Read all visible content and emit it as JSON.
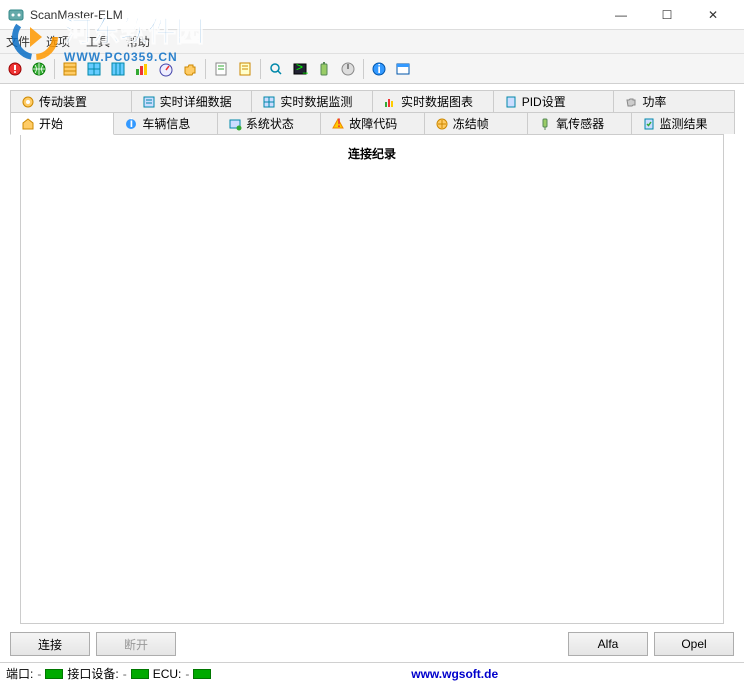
{
  "title": "ScanMaster-ELM",
  "window_buttons": {
    "min": "—",
    "max": "☐",
    "close": "✕"
  },
  "menu": {
    "file": "文件",
    "options": "选项",
    "tools": "工具",
    "help": "帮助"
  },
  "watermark": {
    "cn": "河东软件园",
    "url": "WWW.PC0359.CN"
  },
  "tabs_row1": [
    {
      "label": "传动装置"
    },
    {
      "label": "实时详细数据"
    },
    {
      "label": "实时数据监测"
    },
    {
      "label": "实时数据图表"
    },
    {
      "label": "PID设置"
    },
    {
      "label": "功率"
    }
  ],
  "tabs_row2": [
    {
      "label": "开始"
    },
    {
      "label": "车辆信息"
    },
    {
      "label": "系统状态"
    },
    {
      "label": "故障代码"
    },
    {
      "label": "冻结帧"
    },
    {
      "label": "氧传感器"
    },
    {
      "label": "监测结果"
    }
  ],
  "content": {
    "heading": "连接纪录"
  },
  "buttons": {
    "connect": "连接",
    "disconnect": "断开",
    "alfa": "Alfa",
    "opel": "Opel"
  },
  "status": {
    "port": "端口:",
    "interface": "接口设备:",
    "ecu": "ECU:",
    "dash": "-",
    "link": "www.wgsoft.de"
  }
}
